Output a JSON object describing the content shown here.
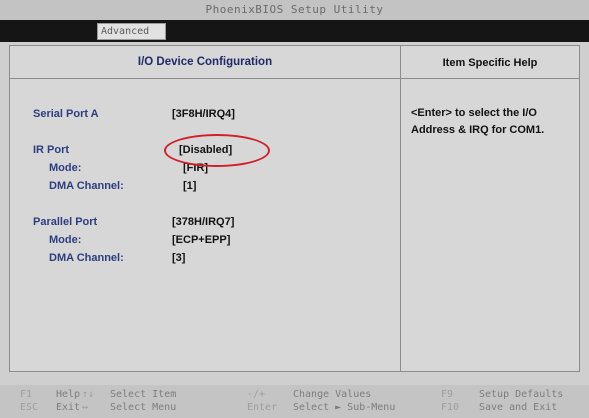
{
  "window": {
    "title": "PhoenixBIOS Setup Utility"
  },
  "menu": {
    "active_tab": "Advanced"
  },
  "panel": {
    "title": "I/O Device Configuration",
    "help_title": "Item Specific Help",
    "help_text": "<Enter> to select the I/O Address & IRQ for COM1.",
    "settings": [
      {
        "label": "Serial Port A",
        "value": "[3F8H/IRQ4]"
      },
      {
        "label": "IR Port",
        "value": "[Disabled]",
        "selected": true
      },
      {
        "label": "Mode:",
        "value": "[FIR]"
      },
      {
        "label": "DMA Channel:",
        "value": "[1]"
      },
      {
        "label": "Parallel Port",
        "value": "[378H/IRQ7]"
      },
      {
        "label": "Mode:",
        "value": "[ECP+EPP]"
      },
      {
        "label": "DMA Channel:",
        "value": "[3]"
      }
    ]
  },
  "keys": [
    {
      "key": "F1",
      "action": "Help"
    },
    {
      "key": "↑↓",
      "action": "Select Item"
    },
    {
      "key": "-/+",
      "action": "Change Values"
    },
    {
      "key": "F9",
      "action": "Setup Defaults"
    },
    {
      "key": "ESC",
      "action": "Exit"
    },
    {
      "key": "↔",
      "action": "Select Menu"
    },
    {
      "key": "Enter",
      "action": "Select ► Sub-Menu"
    },
    {
      "key": "F10",
      "action": "Save and Exit"
    }
  ],
  "colors": {
    "accent": "#2c3e80",
    "highlight_ring": "#d1202a",
    "menubar": "#151515"
  }
}
